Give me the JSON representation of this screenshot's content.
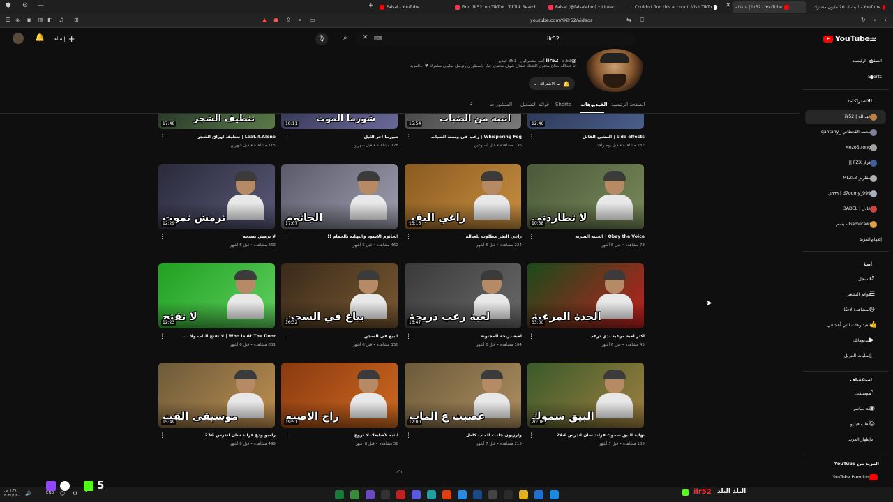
{
  "browser": {
    "tabs": [
      {
        "label": "Faisal - YouTube",
        "color": "#ff0000"
      },
      {
        "label": "Find 'ilr52' on TikTok | TikTok Search",
        "color": "#ff3050"
      },
      {
        "label": "Faisal (@faisal4bro) • Linkac",
        "color": "#ff3050"
      },
      {
        "label": "Couldn't find this account. Visit TikTo",
        "color": "#ffffff"
      },
      {
        "label": "عبدالله | ilr52 - YouTube",
        "color": "#ff0000"
      },
      {
        "label": "بث الـ 20 مليون مشترك ! - YouTube",
        "color": "#ff0000"
      }
    ],
    "url": "youtube.com/@ilr52/videos"
  },
  "header": {
    "search_value": "ilr52",
    "create_label": "إنشاء",
    "logo_text": "YouTube",
    "logo_region": "SA"
  },
  "channel": {
    "handle": "@ilr52",
    "stats": "3.51 ألف مشتركين - 361 فيديو",
    "description": "انا عبدالله صالح محتوى اكشنك عشان شوف محتوى جبار واسطوري ونوصل لمليون مشترك ♥ ...المزيد",
    "subscribe_label": "تم الاشتراك",
    "tabs": [
      "الصفحة الرئيسية",
      "الفيديوهات",
      "Shorts",
      "قوائم التشغيل",
      "المنشورات"
    ],
    "active_tab": 1
  },
  "videos": {
    "row0": [
      {
        "title": "side effects | المشي القاتل",
        "meta": "232 مشاهدة • قبل يوم واحد",
        "duration": "12:46",
        "overlay": "",
        "c1": "#2e3a5a",
        "c2": "#4a5f8a"
      },
      {
        "title": "Whispering Fog | رعب في وسط الضباب",
        "meta": "136 مشاهدة • قبل أسبوعين",
        "duration": "15:54",
        "overlay": "انتبه من الضباب",
        "c1": "#4a4a4a",
        "c2": "#7a7a7a"
      },
      {
        "title": "شورما اخر الليل",
        "meta": "178 مشاهدة • قبل شهرين",
        "duration": "18:11",
        "overlay": "شورما الموت",
        "c1": "#3a3a5a",
        "c2": "#6a6a9a"
      },
      {
        "title": "Leaf.it.Alone | تنظيف اوراق الشجر",
        "meta": "115 مشاهدة • قبل شهرين",
        "duration": "17:48",
        "overlay": "تنظيف الشجر",
        "c1": "#2a3a2a",
        "c2": "#5a7a4a"
      }
    ],
    "row1": [
      {
        "title": "Obey the Voice | الجنية السرية",
        "meta": "78 مشاهدة • قبل 6 أشهر",
        "duration": "10:58",
        "overlay": "لا تطاردني",
        "c1": "#4a5a3a",
        "c2": "#7a8a5a"
      },
      {
        "title": "راعي البقر مطلوب للعدالة",
        "meta": "224 مشاهدة • قبل 6 أشهر",
        "duration": "13:16",
        "overlay": "راعي البقر",
        "c1": "#8a5a20",
        "c2": "#c89040"
      },
      {
        "title": "الجاثوم الاسود والنهاية بالحمام !!",
        "meta": "462 مشاهدة • قبل 6 أشهر",
        "duration": "17:07",
        "overlay": "الجاثوم",
        "c1": "#5a5a6a",
        "c2": "#a0a0b0"
      },
      {
        "title": "لا ترمش نصيحة",
        "meta": "263 مشاهدة • قبل 6 أشهر",
        "duration": "12:29",
        "overlay": "ترمش تموت",
        "c1": "#2a2a3a",
        "c2": "#5a5a7a"
      }
    ],
    "row2": [
      {
        "title": "اكثر لعبة مرعبة بدي ترعب",
        "meta": "45 مشاهدة • قبل 6 أشهر",
        "duration": "33:00",
        "overlay": "الجدة المرعبة",
        "c1": "#1a4a1a",
        "c2": "#c02020"
      },
      {
        "title": "لعبة دريحة المجنونة",
        "meta": "104 مشاهدة • قبل 6 أشهر",
        "duration": "16:47",
        "overlay": "لعبة رعب دريحة",
        "c1": "#3a3a3a",
        "c2": "#6a6a6a"
      },
      {
        "title": "البيع في السجن",
        "meta": "158 مشاهدة • قبل 6 أشهر",
        "duration": "16:32",
        "overlay": "بياع في السجن",
        "c1": "#3a2a1a",
        "c2": "#7a5a30"
      },
      {
        "title": "Who Is At The Door | لا تفتح الباب ولا ...",
        "meta": "851 مشاهدة • قبل 6 أشهر",
        "duration": "12:23",
        "overlay": "لا تفتح",
        "c1": "#20a020",
        "c2": "#60d060"
      }
    ],
    "row3": [
      {
        "title": "نهاية البيق سموك قراند سان اندرس #24",
        "meta": "185 مشاهدة • قبل 7 أشهر",
        "duration": "20:08",
        "overlay": "البيق سموك",
        "c1": "#3a5a2a",
        "c2": "#a08040"
      },
      {
        "title": "وارزيون جلدت الماب كامل",
        "meta": "215 مشاهدة • قبل 7 أشهر",
        "duration": "12:00",
        "overlay": "عصبت ع الماب",
        "c1": "#6a5a3a",
        "c2": "#b09060"
      },
      {
        "title": "انتبه لأصابعك لا تروح",
        "meta": "58 مشاهدة • قبل 8 أشهر",
        "duration": "19:51",
        "overlay": "راح الاصبع",
        "c1": "#8a3a10",
        "c2": "#d06a20"
      },
      {
        "title": "رامبو ودع قراند سان اندرس #23",
        "meta": "499 مشاهدة • قبل 8 أشهر",
        "duration": "15:49",
        "overlay": "موسيقى القت",
        "c1": "#6a5a3a",
        "c2": "#c09050"
      }
    ]
  },
  "sidebar": {
    "main": [
      "الصفحة الرئيسية",
      "Shorts"
    ],
    "subs_title": "الاشتراكات",
    "subs": [
      {
        "label": "عبدالله | ilr52",
        "color": "#c08040"
      },
      {
        "label": "محمد القحطاني _qahtany",
        "color": "#8080a0"
      },
      {
        "label": "MezoStrong",
        "color": "#a0a0a0"
      },
      {
        "label": "فراز FZX ||",
        "color": "#4060a0"
      },
      {
        "label": "مقلزلز MLZLZ",
        "color": "#b0b0b0"
      },
      {
        "label": "d7oomy_999 | ٩٩٩ي",
        "color": "#a0b0c0"
      },
      {
        "label": "عادل | 3ADEL",
        "color": "#d04040"
      },
      {
        "label": "Gamerawi - يسم",
        "color": "#e0a040"
      }
    ],
    "subs_more": "إظهار المزيد",
    "you_title": "أنت",
    "you": [
      "السجل",
      "قوائم التشغيل",
      "المشاهدة لاحقًا",
      "الفيديوهات التي أعجبتني",
      "فيديوهاتك",
      "عمليات التنزيل"
    ],
    "explore_title": "استكشاف",
    "explore": [
      "موسيقى",
      "بث مباشر",
      "ألعاب فيديو",
      "إظهار المزيد"
    ],
    "more_title": "المزيد من YouTube",
    "premium": "YouTube Premium"
  },
  "stream_overlay": {
    "left_text": "5",
    "right_handle": "ilr52",
    "right_text": "البلد البلد"
  },
  "taskbar": {
    "lang": "ENG",
    "time": "٥:٣٩ ص",
    "date": "٢٠٢٤/١/٢٠"
  }
}
